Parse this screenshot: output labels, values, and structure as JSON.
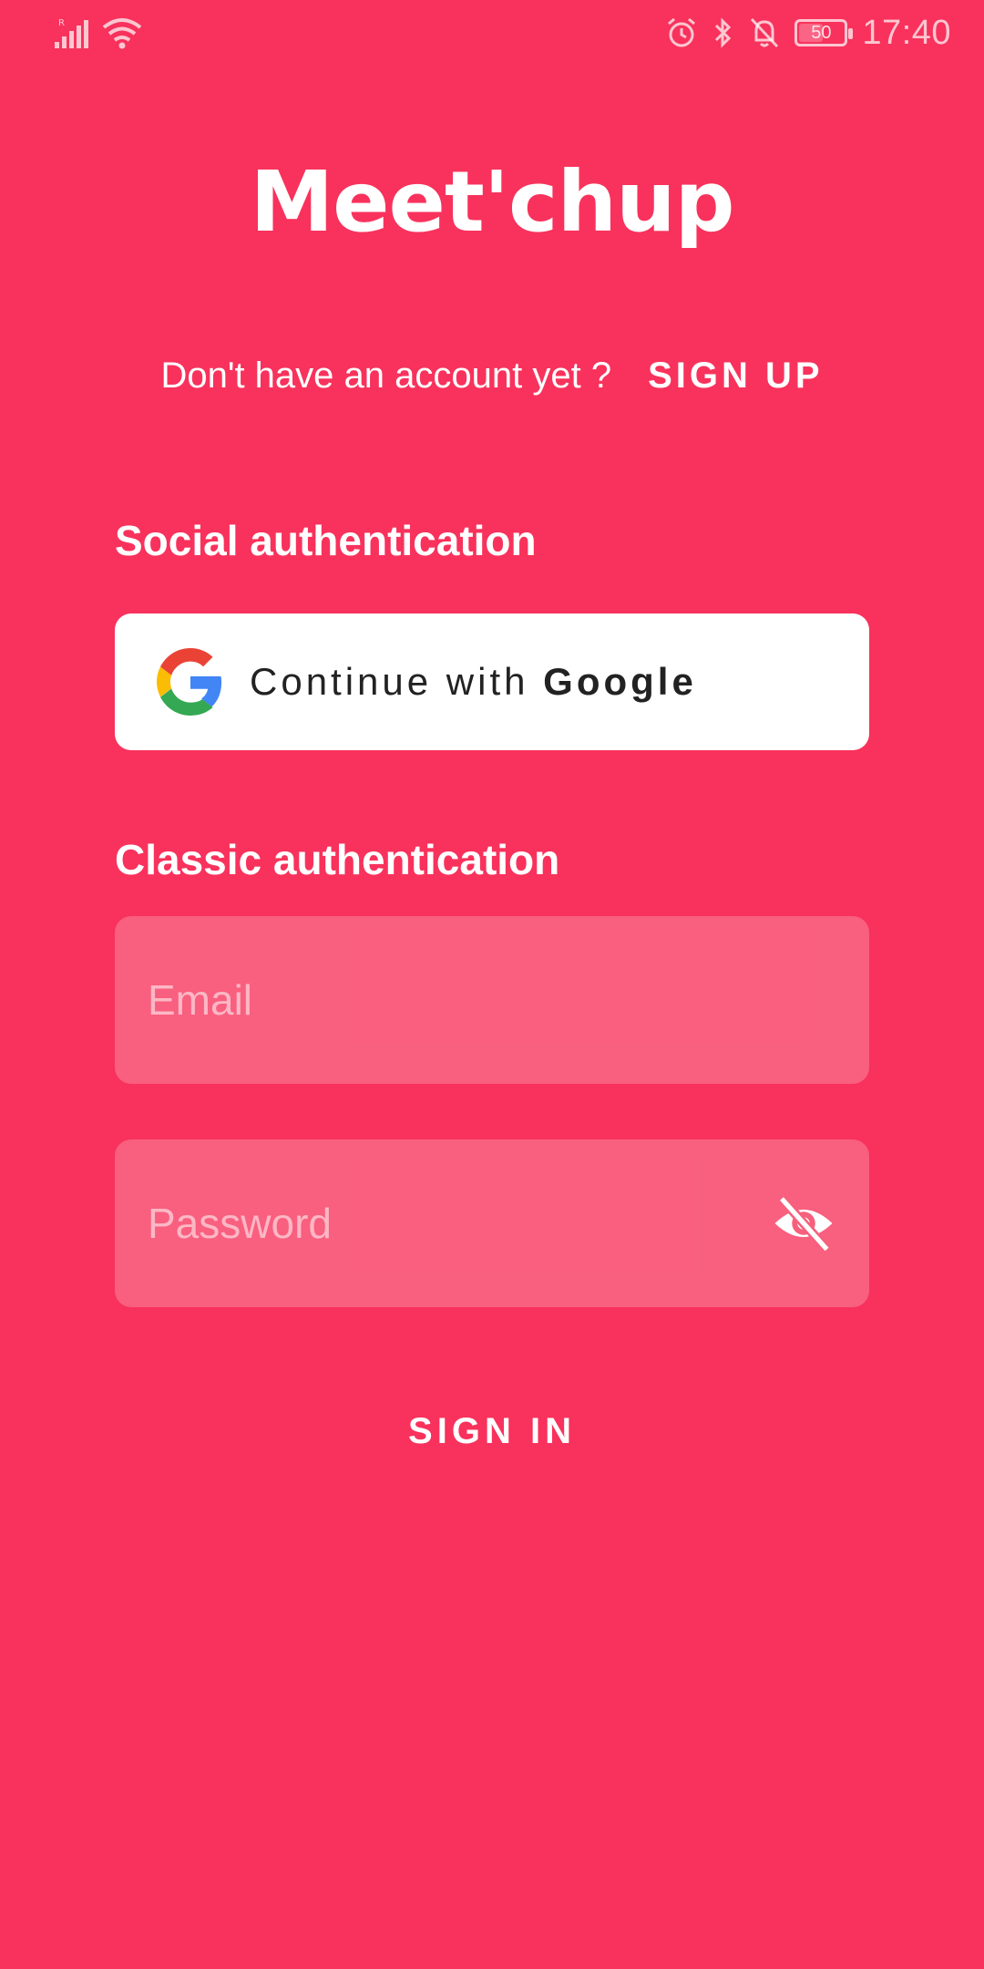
{
  "status_bar": {
    "time": "17:40",
    "battery": "50",
    "battery_level": 0.5,
    "icons": [
      "signal-icon",
      "wifi-icon",
      "alarm-icon",
      "bluetooth-icon",
      "bell-off-icon",
      "battery-icon"
    ]
  },
  "app": {
    "logo_text": "Meet'chup"
  },
  "signup": {
    "prompt": "Don't have an account yet ?",
    "link_label": "SIGN UP"
  },
  "social": {
    "title": "Social authentication",
    "google_prefix": "Continue with",
    "google_brand": "Google"
  },
  "classic": {
    "title": "Classic authentication",
    "email_placeholder": "Email",
    "email_value": "",
    "password_placeholder": "Password",
    "password_value": ""
  },
  "signin": {
    "label": "SIGN IN"
  },
  "colors": {
    "background": "#F8325C",
    "field_fill": "rgba(255,255,255,0.22)",
    "text": "#FFFFFF"
  }
}
